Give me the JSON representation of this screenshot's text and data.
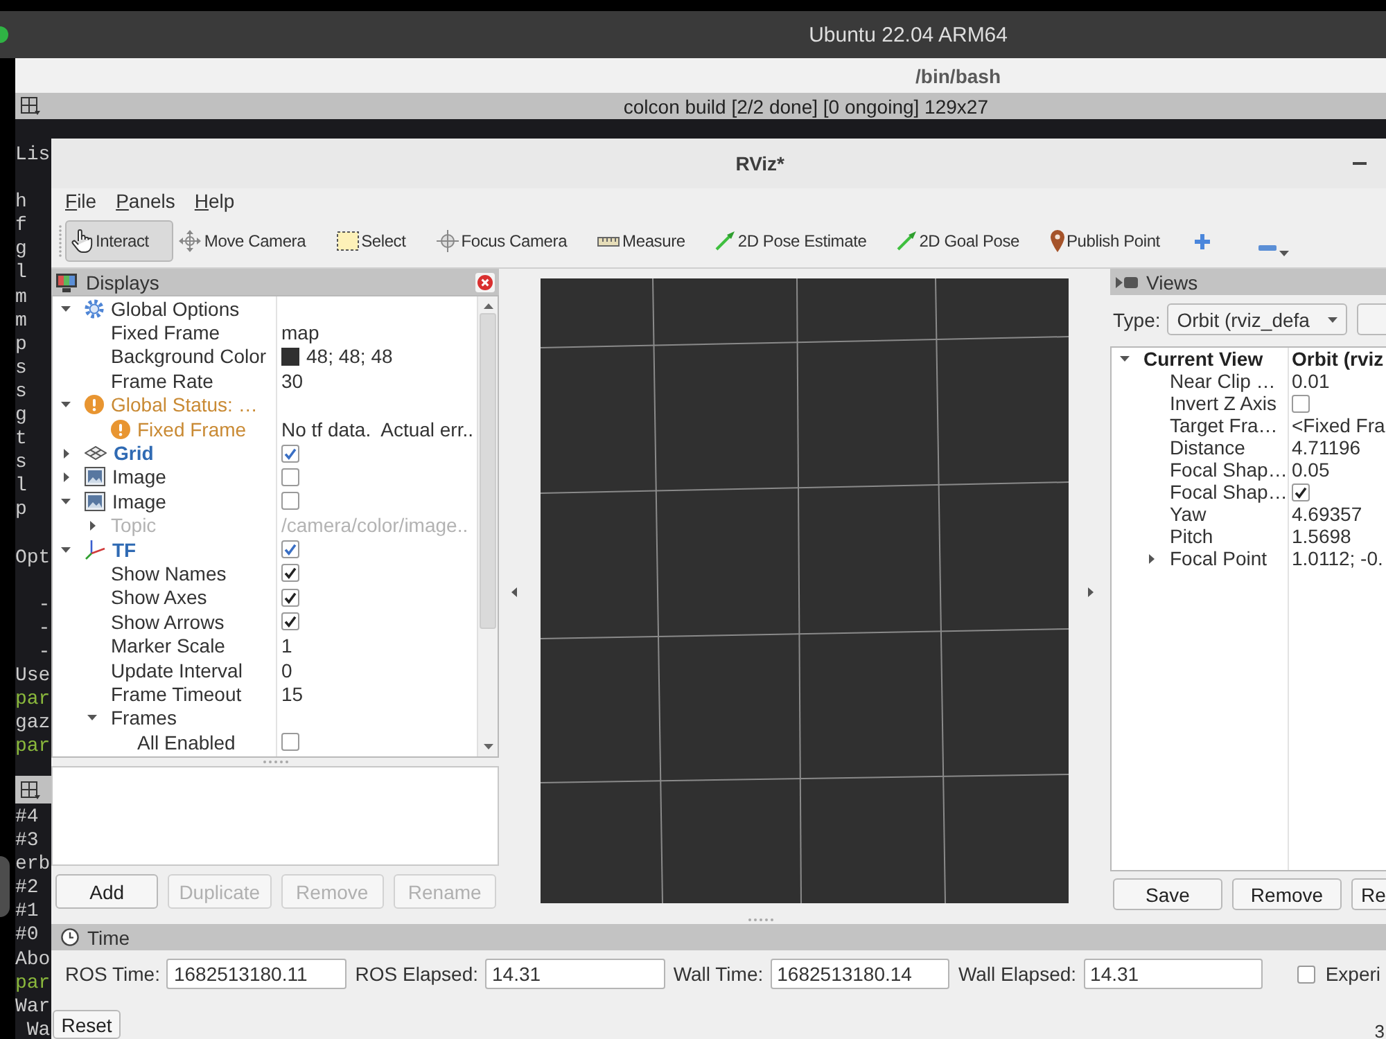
{
  "vm_window": {
    "title": "Ubuntu 22.04 ARM64"
  },
  "terminal": {
    "title": "/bin/bash",
    "tab_title": "colcon build [2/2 done] [0 ongoing] 129x27",
    "upper_pane": [
      [
        {
          "text": "Lis",
          "color": "#cccccc"
        }
      ],
      [
        {
          "text": "h",
          "color": "#cccccc"
        },
        {
          "text": "f",
          "color": "#cccccc"
        },
        {
          "text": "g",
          "color": "#cccccc"
        },
        {
          "text": "l",
          "color": "#cccccc"
        },
        {
          "text": "m",
          "color": "#cccccc"
        },
        {
          "text": "m",
          "color": "#cccccc"
        },
        {
          "text": "p",
          "color": "#cccccc"
        },
        {
          "text": "s",
          "color": "#cccccc"
        },
        {
          "text": "s",
          "color": "#cccccc"
        },
        {
          "text": "g",
          "color": "#cccccc"
        },
        {
          "text": "t",
          "color": "#cccccc"
        },
        {
          "text": "s",
          "color": "#cccccc"
        },
        {
          "text": "l",
          "color": "#cccccc"
        },
        {
          "text": "p",
          "color": "#cccccc"
        }
      ],
      [
        {
          "text": "Opt",
          "color": "#cccccc"
        }
      ],
      [
        {
          "text": "  -",
          "color": "#cccccc"
        },
        {
          "text": "  -",
          "color": "#cccccc"
        },
        {
          "text": "  -",
          "color": "#cccccc"
        },
        {
          "text": "Use",
          "color": "#cccccc"
        },
        {
          "text": "par",
          "color": "#8ab83c"
        },
        {
          "text": "gaz",
          "color": "#cccccc"
        },
        {
          "text": "par",
          "color": "#8ab83c"
        }
      ]
    ],
    "lower_pane": [
      [
        {
          "text": "#4",
          "color": "#cccccc"
        },
        {
          "text": "#3",
          "color": "#cccccc"
        },
        {
          "text": "erb",
          "color": "#cccccc"
        },
        {
          "text": "#2",
          "color": "#cccccc"
        },
        {
          "text": "#1",
          "color": "#cccccc"
        },
        {
          "text": "#0",
          "color": "#cccccc"
        },
        {
          "text": "Abo",
          "color": "#cccccc"
        },
        {
          "text": "par",
          "color": "#8ab83c"
        },
        {
          "text": "War",
          "color": "#cccccc"
        },
        {
          "text": " Wa",
          "color": "#cccccc"
        }
      ]
    ]
  },
  "rviz_window": {
    "title": "RViz*",
    "menu": [
      "File",
      "Panels",
      "Help"
    ],
    "tools": [
      {
        "kind": "interact",
        "label": "Interact",
        "selected": true
      },
      {
        "kind": "move_camera",
        "label": "Move Camera",
        "selected": false
      },
      {
        "kind": "select",
        "label": "Select",
        "selected": false
      },
      {
        "kind": "focus_camera",
        "label": "Focus Camera",
        "selected": false
      },
      {
        "kind": "measure",
        "label": "Measure",
        "selected": false
      },
      {
        "kind": "pose_estimate",
        "label": "2D Pose Estimate",
        "selected": false
      },
      {
        "kind": "goal_pose",
        "label": "2D Goal Pose",
        "selected": false
      },
      {
        "kind": "publish_point",
        "label": "Publish Point",
        "selected": false
      }
    ],
    "tool_actions": [
      {
        "kind": "add"
      },
      {
        "kind": "remove"
      }
    ],
    "displays": {
      "title": "Displays",
      "items": [
        {
          "kind": "options",
          "label": "Global Options",
          "expanded": true,
          "children": [
            {
              "kind": "property",
              "label": "Fixed Frame",
              "value": "map"
            },
            {
              "kind": "property",
              "label": "Background Color",
              "value": "48; 48; 48",
              "color": "#303030"
            },
            {
              "kind": "property",
              "label": "Frame Rate",
              "value": "30"
            }
          ]
        },
        {
          "kind": "status",
          "label": "Global Status: …",
          "expanded": true,
          "children": [
            {
              "kind": "status",
              "label": "Fixed Frame",
              "value": "No tf data.  Actual err.."
            }
          ]
        },
        {
          "kind": "grid",
          "label": "Grid",
          "checked": true,
          "expanded": false
        },
        {
          "kind": "image",
          "label": "Image",
          "checked": false,
          "expanded": false
        },
        {
          "kind": "image",
          "label": "Image",
          "checked": false,
          "expanded": true,
          "children": [
            {
              "kind": "property",
              "label": "Topic",
              "value": "/camera/color/image..",
              "disabled": true,
              "expanded": false
            }
          ]
        },
        {
          "kind": "tf",
          "label": "TF",
          "checked": true,
          "expanded": true,
          "children": [
            {
              "kind": "property",
              "label": "Show Names",
              "checked": true
            },
            {
              "kind": "property",
              "label": "Show Axes",
              "checked": true
            },
            {
              "kind": "property",
              "label": "Show Arrows",
              "checked": true
            },
            {
              "kind": "property",
              "label": "Marker Scale",
              "value": "1"
            },
            {
              "kind": "property",
              "label": "Update Interval",
              "value": "0"
            },
            {
              "kind": "property",
              "label": "Frame Timeout",
              "value": "15"
            },
            {
              "kind": "property",
              "label": "Frames",
              "expanded": true,
              "children": [
                {
                  "kind": "property",
                  "label": "All Enabled",
                  "checked": false
                }
              ]
            }
          ]
        }
      ],
      "buttons": [
        {
          "label": "Add",
          "disabled": false
        },
        {
          "label": "Duplicate",
          "disabled": true
        },
        {
          "label": "Remove",
          "disabled": true
        },
        {
          "label": "Rename",
          "disabled": true
        }
      ]
    },
    "views": {
      "title": "Views",
      "type_label": "Type:",
      "type_value": "Orbit (rviz_defa",
      "items": [
        {
          "kind": "group",
          "label": "Current View",
          "value": "Orbit (rviz",
          "expanded": true,
          "children": [
            {
              "kind": "property",
              "label": "Near Clip …",
              "value": "0.01"
            },
            {
              "kind": "property",
              "label": "Invert Z Axis",
              "checked": false
            },
            {
              "kind": "property",
              "label": "Target Fra…",
              "value": "<Fixed Fra"
            },
            {
              "kind": "property",
              "label": "Distance",
              "value": "4.71196"
            },
            {
              "kind": "property",
              "label": "Focal Shap…",
              "value": "0.05"
            },
            {
              "kind": "property",
              "label": "Focal Shap…",
              "checked": true
            },
            {
              "kind": "property",
              "label": "Yaw",
              "value": "4.69357"
            },
            {
              "kind": "property",
              "label": "Pitch",
              "value": "1.5698"
            },
            {
              "kind": "property",
              "label": "Focal Point",
              "value": "1.0112; -0.",
              "expanded": false
            }
          ]
        }
      ],
      "buttons": [
        {
          "label": "Save",
          "disabled": false
        },
        {
          "label": "Remove",
          "disabled": false
        },
        {
          "label": "Re",
          "disabled": false
        }
      ]
    },
    "time": {
      "title": "Time",
      "fields": [
        {
          "label": "ROS Time:",
          "value": "1682513180.11"
        },
        {
          "label": "ROS Elapsed:",
          "value": "14.31"
        },
        {
          "label": "Wall Time:",
          "value": "1682513180.14"
        },
        {
          "label": "Wall Elapsed:",
          "value": "14.31"
        }
      ],
      "experimental": {
        "label": "Experi",
        "checked": false
      },
      "reset_button": "Reset",
      "corner_text": "3"
    }
  }
}
